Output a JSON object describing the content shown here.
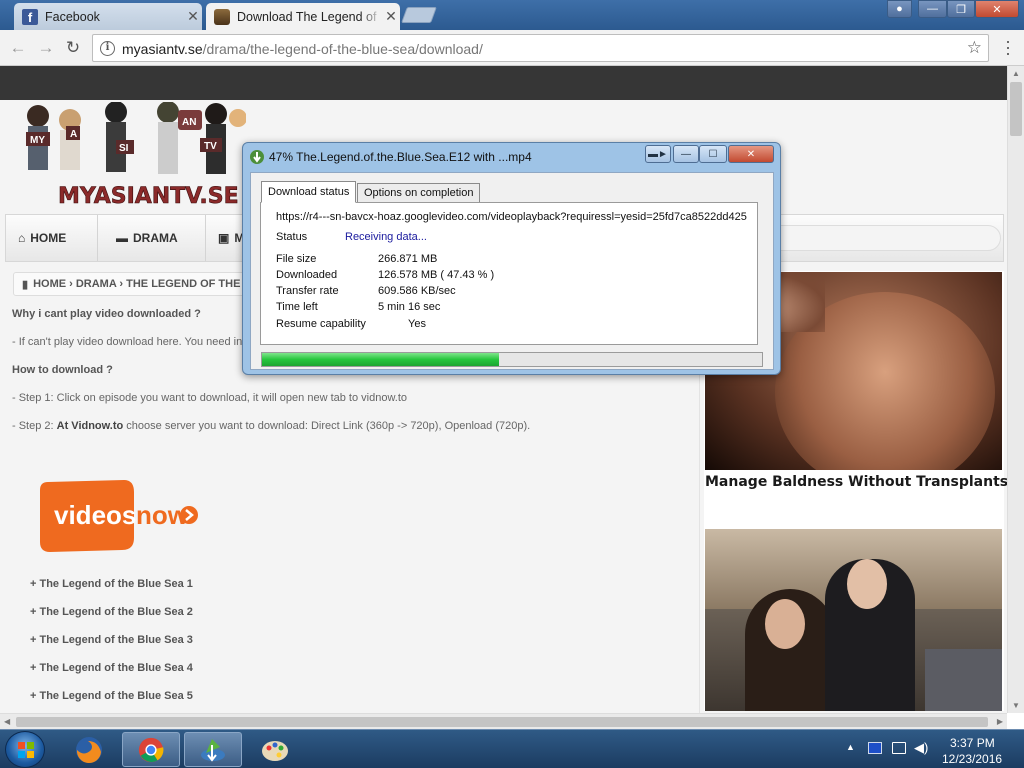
{
  "browser": {
    "tabs": [
      {
        "title": "Facebook",
        "icon": "facebook-icon"
      },
      {
        "title": "Download The Legend of",
        "icon": "tv-favicon-icon"
      }
    ],
    "url_domain": "myasiantv.se",
    "url_path": "/drama/the-legend-of-the-blue-sea/download/"
  },
  "site": {
    "logo_text": "MYASIANTV.SE",
    "logo_badges": [
      "MY",
      "A",
      "SI",
      "AN",
      "TV"
    ],
    "nav": [
      {
        "label": "HOME",
        "icon": "home-icon"
      },
      {
        "label": "DRAMA",
        "icon": "folder-icon"
      },
      {
        "label": "M",
        "icon": "film-icon"
      }
    ],
    "breadcrumb": "HOME › DRAMA › THE LEGEND OF THE B",
    "q1": "Why i cant play video downloaded ?",
    "a1": "- If can't play video download here. You need in",
    "q2": "How to download ?",
    "step1": "- Step 1: Click on episode you want to download, it will open new tab to vidnow.to",
    "step2_prefix": "- Step 2: ",
    "step2_bold": "At Vidnow.to",
    "step2_rest": " choose server you want to download: Direct Link (360p -> 720p), Openload (720p).",
    "vidnow_logo": {
      "word1": "videos",
      "word2": "now"
    },
    "episodes": [
      "+ The Legend of the Blue Sea 1",
      "+ The Legend of the Blue Sea 2",
      "+ The Legend of the Blue Sea 3",
      "+ The Legend of the Blue Sea 4",
      "+ The Legend of the Blue Sea 5"
    ],
    "ad_title": "Manage Baldness Without Transplants"
  },
  "dialog": {
    "title": "47% The.Legend.of.the.Blue.Sea.E12 with ...mp4",
    "tabs": [
      "Download status",
      "Options on completion"
    ],
    "url": "https://r4---sn-bavcx-hoaz.googlevideo.com/videoplayback?requiressl=yesid=25fd7ca8522dd425",
    "status_label": "Status",
    "status_value": "Receiving data...",
    "filesize_label": "File size",
    "filesize_value": "266.871  MB",
    "downloaded_label": "Downloaded",
    "downloaded_value": "126.578  MB  ( 47.43 % )",
    "rate_label": "Transfer rate",
    "rate_value": "609.586  KB/sec",
    "timeleft_label": "Time left",
    "timeleft_value": "5 min 16 sec",
    "resume_label": "Resume capability",
    "resume_value": "Yes",
    "progress_fraction": 0.4743
  },
  "taskbar": {
    "apps": [
      "firefox-icon",
      "chrome-icon",
      "idm-icon",
      "paint-icon"
    ],
    "time": "3:37 PM",
    "date": "12/23/2016"
  },
  "colors": {
    "status_value": "#1a1a9e",
    "progress_green": "#26c63d",
    "vidnow_orange": "#ef6a1f",
    "taskbar": "#1c3c61"
  }
}
